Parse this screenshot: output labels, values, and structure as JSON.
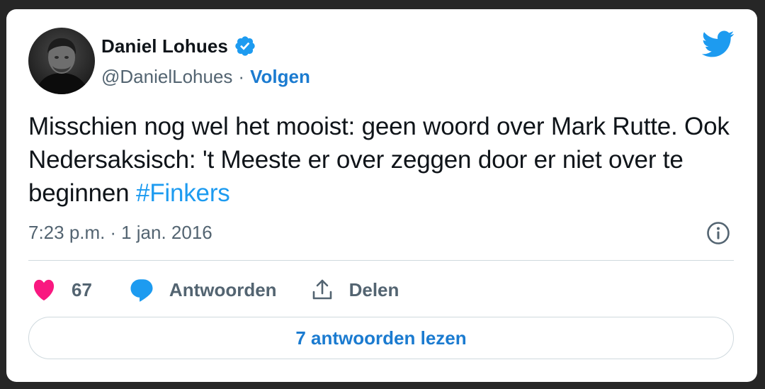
{
  "author": {
    "display_name": "Daniel Lohues",
    "handle": "@DanielLohues",
    "separator": "·",
    "follow_label": "Volgen",
    "verified": true
  },
  "tweet": {
    "text": "Misschien nog wel het mooist: geen woord over Mark Rutte. Ook Nedersaksisch: 't Meeste er over zeggen door er niet over te beginnen ",
    "hashtag": "#Finkers",
    "time": "7:23 p.m.",
    "date_separator": "·",
    "date": "1 jan. 2016"
  },
  "actions": {
    "like_count": "67",
    "reply_label": "Antwoorden",
    "share_label": "Delen"
  },
  "read_replies_label": "7 antwoorden lezen",
  "icons": {
    "avatar": "avatar-photo",
    "verified": "verified-badge-icon",
    "logo": "twitter-bird-icon",
    "info": "info-icon",
    "like": "heart-icon",
    "reply": "speech-bubble-icon",
    "share": "share-upload-icon"
  },
  "colors": {
    "link_blue": "#1b7bd0",
    "hashtag_blue": "#1d9bf0",
    "twitter_blue": "#1d9bf0",
    "heart_pink": "#f91880",
    "text_dark": "#0f1419",
    "text_gray": "#536471",
    "border": "#cfd9de",
    "background": "#262626"
  }
}
